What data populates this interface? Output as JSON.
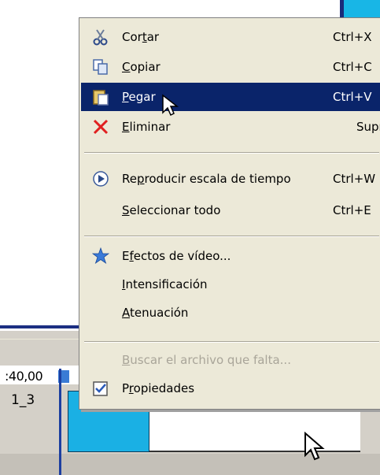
{
  "menu": {
    "items": [
      {
        "pre": "Cor",
        "key": "t",
        "post": "ar",
        "shortcut": "Ctrl+X",
        "icon": "scissors-icon"
      },
      {
        "pre": "",
        "key": "C",
        "post": "opiar",
        "shortcut": "Ctrl+C",
        "icon": "copy-icon"
      },
      {
        "pre": "",
        "key": "P",
        "post": "egar",
        "shortcut": "Ctrl+V",
        "icon": "paste-icon",
        "selected": true
      },
      {
        "pre": "",
        "key": "E",
        "post": "liminar",
        "shortcut": "Supr",
        "icon": "delete-icon"
      },
      {
        "pre": "Re",
        "key": "p",
        "post": "roducir escala de tiempo",
        "shortcut": "Ctrl+W",
        "icon": "play-icon"
      },
      {
        "pre": "",
        "key": "S",
        "post": "eleccionar todo",
        "shortcut": "Ctrl+E"
      },
      {
        "pre": "E",
        "key": "f",
        "post": "ectos de vídeo...",
        "shortcut": "",
        "icon": "star-icon"
      },
      {
        "pre": "",
        "key": "I",
        "post": "ntensificación",
        "shortcut": ""
      },
      {
        "pre": "",
        "key": "A",
        "post": "tenuación",
        "shortcut": ""
      },
      {
        "pre": "",
        "key": "B",
        "post": "uscar el archivo que falta...",
        "shortcut": "",
        "disabled": true
      },
      {
        "pre": "P",
        "key": "r",
        "post": "opiedades",
        "shortcut": "",
        "icon": "properties-icon"
      }
    ]
  },
  "timeline": {
    "timecode": ":40,00",
    "track_label": "1_3"
  },
  "colors": {
    "menu_bg": "#ece9d8",
    "selection": "#0a246a",
    "clip": "#1ab0e4",
    "playhead": "#1c3fa0"
  }
}
